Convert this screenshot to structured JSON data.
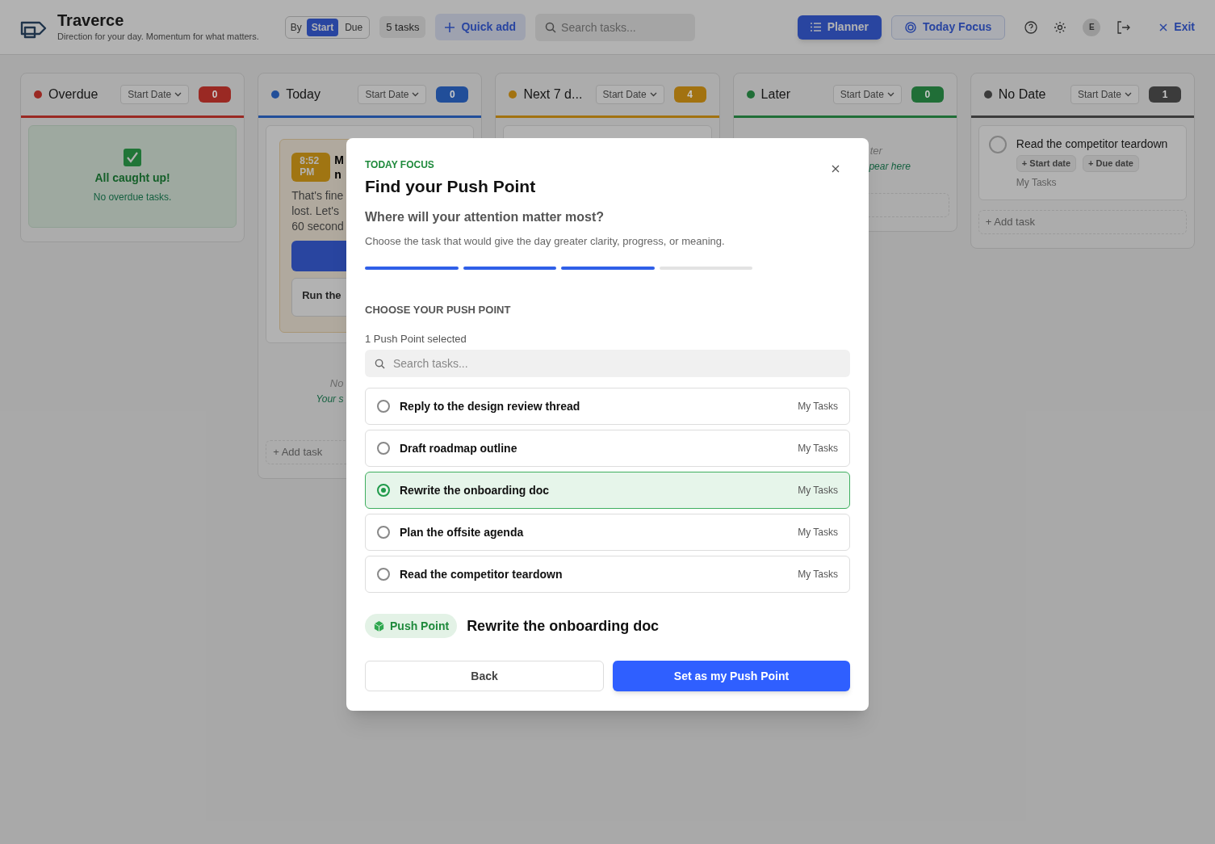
{
  "header": {
    "app_name": "Traverce",
    "tagline": "Direction for your day. Momentum for what matters.",
    "sort_toggle": {
      "label": "By",
      "options": [
        {
          "label": "Start",
          "selected": true
        },
        {
          "label": "Due",
          "selected": false
        }
      ]
    },
    "task_count": "5 tasks",
    "quick_add": "Quick add",
    "search_placeholder": "Search tasks...",
    "views": [
      {
        "label": "Planner",
        "selected": true,
        "kind": "list"
      },
      {
        "label": "Today Focus",
        "selected": false,
        "kind": "target"
      }
    ],
    "avatar": "E",
    "exit": "Exit"
  },
  "columns": [
    {
      "title": "Overdue",
      "color": "#9a2923",
      "sort": "Start Date",
      "count": "0",
      "items": [
        {
          "kind": "empty",
          "title": "All caught up!",
          "text": "No overdue tasks."
        }
      ]
    },
    {
      "title": "Today",
      "color": "#214e99",
      "sort": "Start Date",
      "count": "0",
      "items": [
        {
          "kind": "focus",
          "time": "8:52 PM",
          "title_lines": [
            "M",
            "n"
          ],
          "body_lines": [
            "That's fine",
            "lost. Let's",
            "60 second"
          ],
          "next": "Run the"
        },
        {
          "kind": "hint",
          "lines": [
            "No",
            "Your s"
          ]
        },
        {
          "kind": "add",
          "label": "+ Add task"
        }
      ]
    },
    {
      "title": "Next 7 d...",
      "color": "#a27210",
      "sort": "Start Date",
      "count": "4",
      "items": [
        {
          "kind": "stub"
        }
      ]
    },
    {
      "title": "Later",
      "color": "#206e37",
      "sort": "Start Date",
      "count": "0",
      "items": [
        {
          "kind": "hint",
          "lines": [
            "ter",
            "pear here"
          ]
        },
        {
          "kind": "add"
        }
      ]
    },
    {
      "title": "No Date",
      "color": "#3b3b3b",
      "sort": "Start Date",
      "count": "1",
      "items": [
        {
          "kind": "task",
          "done": false,
          "title": "Read the competitor teardown",
          "chips": [
            "+ Start date",
            "+ Due date"
          ],
          "list": "My Tasks"
        },
        {
          "kind": "add",
          "label": "+ Add task"
        }
      ]
    }
  ],
  "dialog": {
    "eyebrow": "TODAY FOCUS",
    "title": "Find your Push Point",
    "question": "Where will your attention matter most?",
    "text": "Choose the task that would give the day greater clarity, progress, or meaning.",
    "steps": [
      {
        "done": true
      },
      {
        "done": true
      },
      {
        "done": true
      },
      {
        "done": false
      }
    ],
    "section": "CHOOSE YOUR PUSH POINT",
    "selected_count": "1 Push Point selected",
    "search_placeholder": "Search tasks...",
    "tasks": [
      {
        "title": "Reply to the design review thread",
        "list": "My Tasks",
        "selected": false
      },
      {
        "title": "Draft roadmap outline",
        "list": "My Tasks",
        "selected": false
      },
      {
        "title": "Rewrite the onboarding doc",
        "list": "My Tasks",
        "selected": true
      },
      {
        "title": "Plan the offsite agenda",
        "list": "My Tasks",
        "selected": false
      },
      {
        "title": "Read the competitor teardown",
        "list": "My Tasks",
        "selected": false
      }
    ],
    "badge": "Push Point",
    "chosen": "Rewrite the onboarding doc",
    "back": "Back",
    "confirm": "Set as my Push Point"
  }
}
